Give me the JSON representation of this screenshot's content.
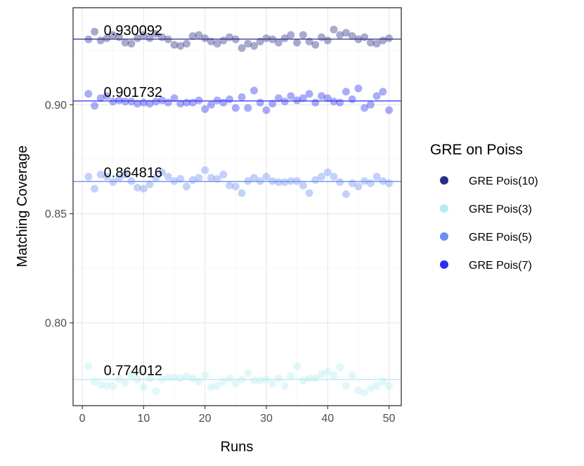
{
  "chart_data": {
    "type": "scatter",
    "xlabel": "Runs",
    "ylabel": "Matching Coverage",
    "xlim": [
      -1.5,
      52
    ],
    "ylim": [
      0.762,
      0.9445
    ],
    "x_ticks": [
      0,
      10,
      20,
      30,
      40,
      50
    ],
    "x_tick_labels": [
      "0",
      "10",
      "20",
      "30",
      "40",
      "50"
    ],
    "y_ticks": [
      0.8,
      0.85,
      0.9
    ],
    "y_tick_labels": [
      "0.80",
      "0.85",
      "0.90"
    ],
    "grid": true,
    "legend": {
      "title": "GRE on Poiss",
      "placement": "right",
      "entries": [
        {
          "label": "GRE Pois(10)",
          "color": "#2b2b87"
        },
        {
          "label": "GRE Pois(3)",
          "color": "#b7ecf0"
        },
        {
          "label": "GRE Pois(5)",
          "color": "#6b8ff2"
        },
        {
          "label": "GRE Pois(7)",
          "color": "#2a2ff0"
        }
      ]
    },
    "series": [
      {
        "name": "GRE Pois(10)",
        "color": "#2b2b87",
        "mean": 0.930092,
        "mean_label": "0.930092",
        "values": [
          0.93,
          0.9335,
          0.9295,
          0.9305,
          0.932,
          0.931,
          0.9285,
          0.928,
          0.9305,
          0.932,
          0.9305,
          0.9325,
          0.931,
          0.93,
          0.9275,
          0.927,
          0.928,
          0.9315,
          0.932,
          0.9305,
          0.929,
          0.928,
          0.9295,
          0.931,
          0.93,
          0.926,
          0.928,
          0.927,
          0.929,
          0.9305,
          0.93,
          0.9285,
          0.9305,
          0.932,
          0.9285,
          0.932,
          0.929,
          0.9275,
          0.931,
          0.9295,
          0.9345,
          0.932,
          0.933,
          0.9315,
          0.93,
          0.931,
          0.9285,
          0.928,
          0.9295,
          0.9305
        ]
      },
      {
        "name": "GRE Pois(3)",
        "color": "#b7ecf0",
        "mean": 0.774012,
        "mean_label": "0.774012",
        "values": [
          0.78,
          0.773,
          0.7715,
          0.771,
          0.771,
          0.774,
          0.7725,
          0.776,
          0.774,
          0.7705,
          0.7745,
          0.7685,
          0.774,
          0.775,
          0.775,
          0.7745,
          0.7755,
          0.7745,
          0.773,
          0.776,
          0.7705,
          0.771,
          0.773,
          0.7745,
          0.772,
          0.774,
          0.777,
          0.7735,
          0.7735,
          0.774,
          0.772,
          0.7745,
          0.771,
          0.7755,
          0.78,
          0.7735,
          0.7745,
          0.7745,
          0.7765,
          0.7775,
          0.776,
          0.7795,
          0.771,
          0.776,
          0.769,
          0.768,
          0.77,
          0.771,
          0.773,
          0.771
        ]
      },
      {
        "name": "GRE Pois(5)",
        "color": "#6b8ff2",
        "mean": 0.864816,
        "mean_label": "0.864816",
        "values": [
          0.867,
          0.8615,
          0.868,
          0.867,
          0.8645,
          0.8665,
          0.868,
          0.865,
          0.862,
          0.8615,
          0.8635,
          0.8665,
          0.869,
          0.867,
          0.865,
          0.866,
          0.8625,
          0.8655,
          0.8665,
          0.87,
          0.8665,
          0.866,
          0.868,
          0.863,
          0.8625,
          0.8595,
          0.865,
          0.8665,
          0.865,
          0.867,
          0.865,
          0.8645,
          0.8645,
          0.865,
          0.865,
          0.863,
          0.8595,
          0.8655,
          0.867,
          0.869,
          0.867,
          0.8645,
          0.859,
          0.864,
          0.8625,
          0.865,
          0.864,
          0.867,
          0.865,
          0.864
        ]
      },
      {
        "name": "GRE Pois(7)",
        "color": "#2a2ff0",
        "mean": 0.901732,
        "mean_label": "0.901732",
        "values": [
          0.905,
          0.8995,
          0.903,
          0.904,
          0.9015,
          0.902,
          0.9015,
          0.9015,
          0.9005,
          0.901,
          0.9005,
          0.9015,
          0.902,
          0.901,
          0.903,
          0.9005,
          0.901,
          0.901,
          0.902,
          0.898,
          0.9,
          0.902,
          0.901,
          0.9025,
          0.8985,
          0.9035,
          0.8985,
          0.9065,
          0.901,
          0.8975,
          0.9005,
          0.903,
          0.9015,
          0.904,
          0.902,
          0.903,
          0.905,
          0.901,
          0.904,
          0.903,
          0.9015,
          0.901,
          0.906,
          0.9025,
          0.9075,
          0.8985,
          0.9,
          0.904,
          0.906,
          0.8975
        ]
      }
    ]
  }
}
